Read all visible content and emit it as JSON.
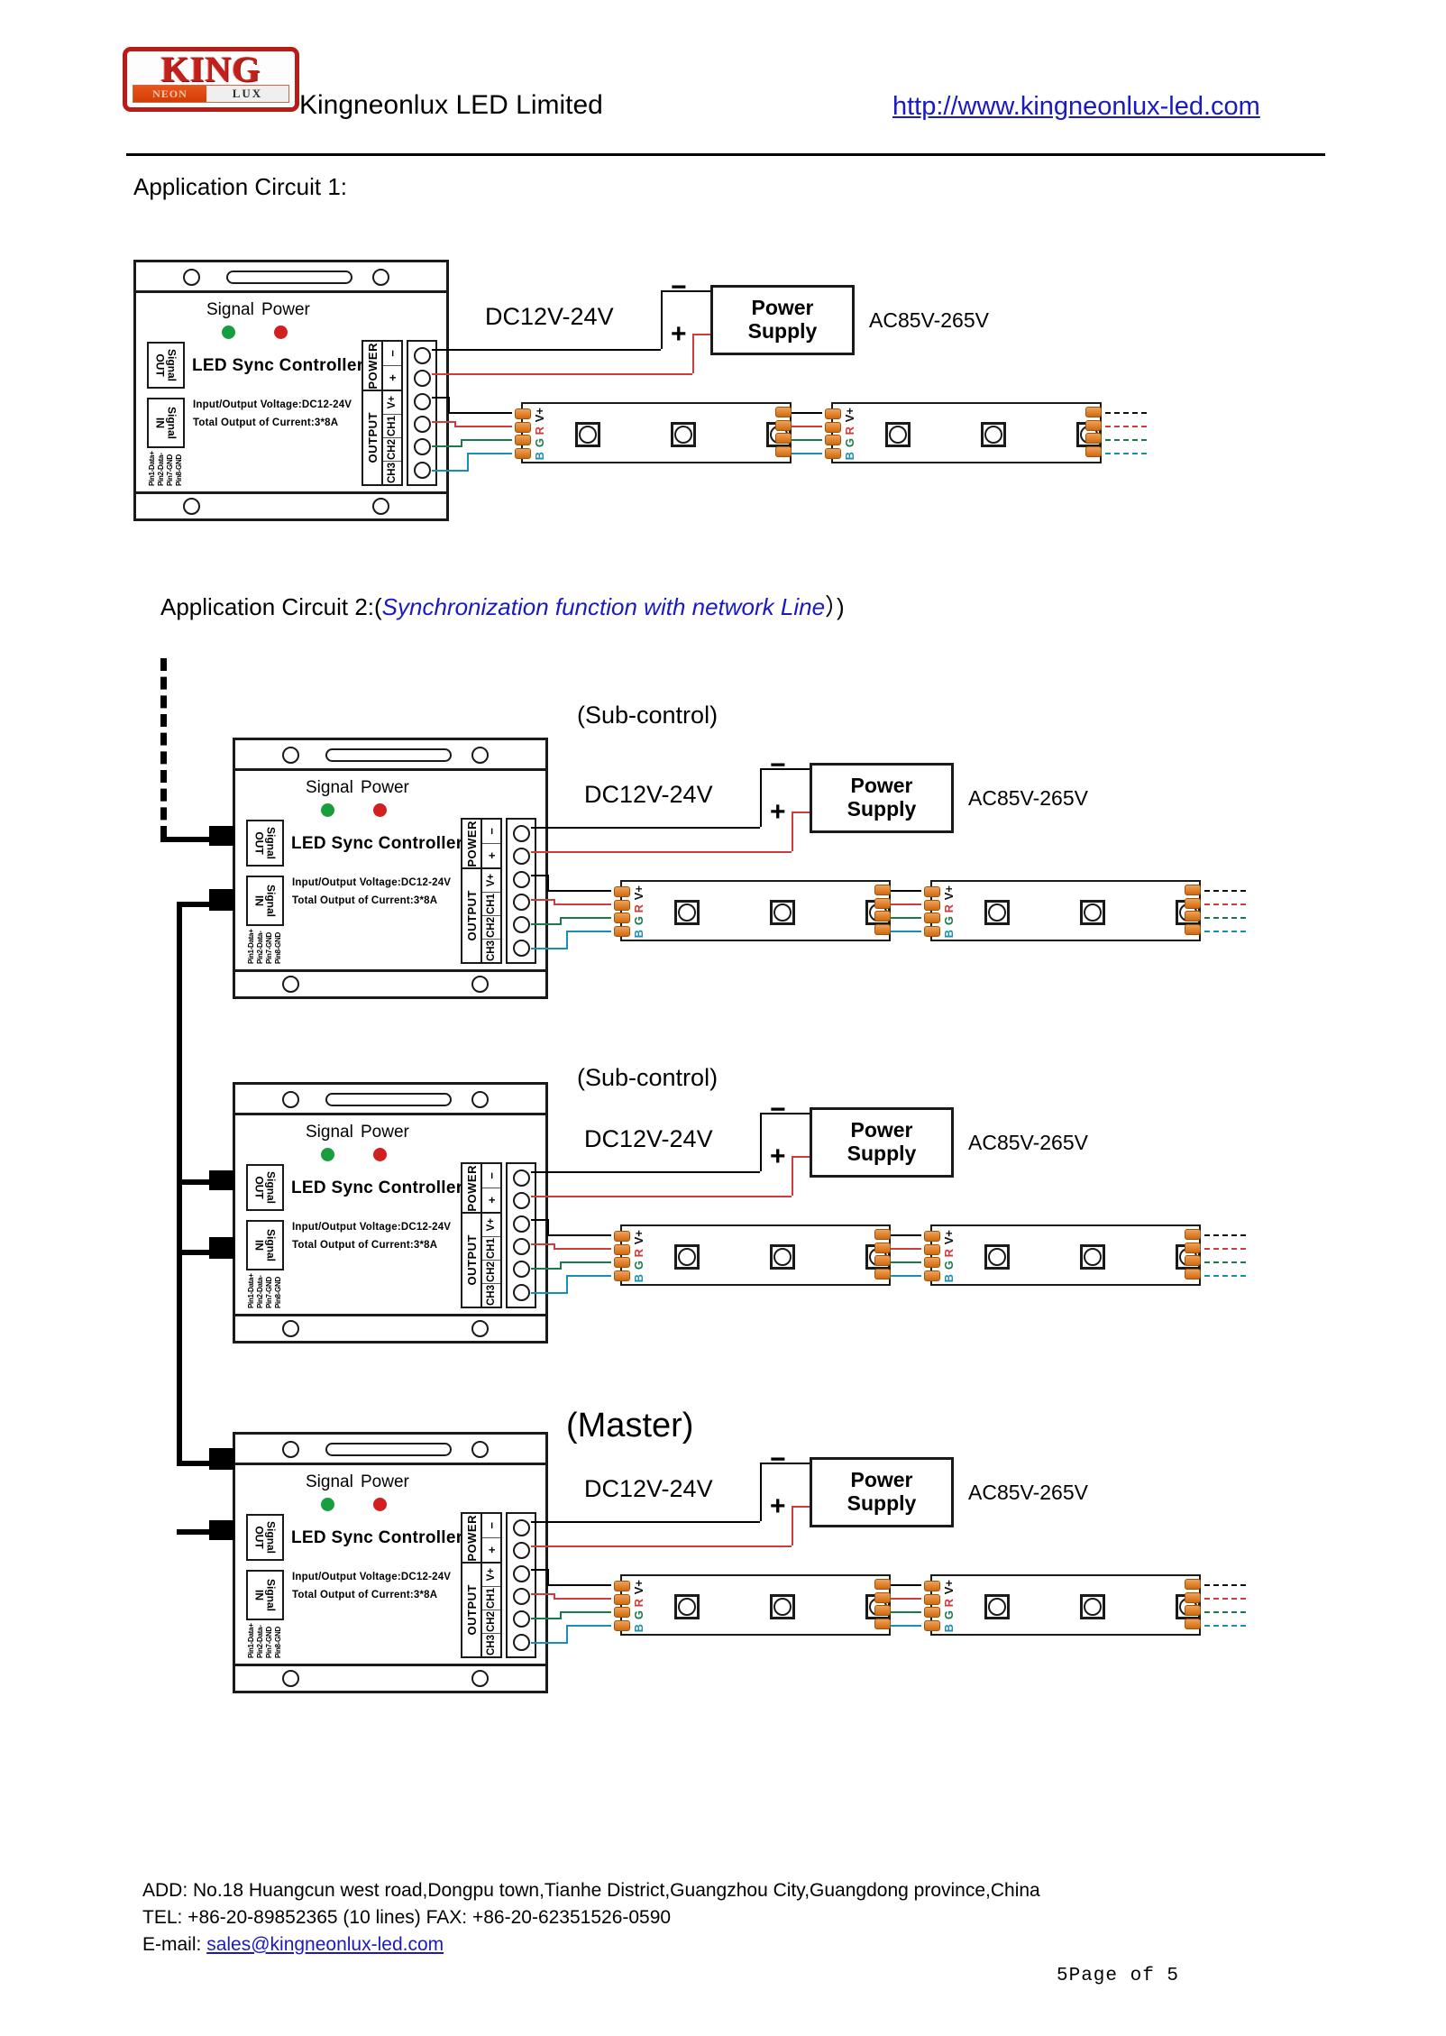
{
  "header": {
    "logo": {
      "king": "KING",
      "neon": "NEON",
      "lux": "LUX"
    },
    "company": "Kingneonlux LED Limited",
    "url": "http://www.kingneonlux-led.com"
  },
  "sections": {
    "circuit1_title": "Application Circuit 1:",
    "circuit2_prefix": "Application Circuit 2:(",
    "circuit2_italic": "Synchronization function with network Line",
    "circuit2_suffix": "）)"
  },
  "controller": {
    "signal_label": "Signal",
    "power_label": "Power",
    "signal_color": "#199e3f",
    "power_color": "#d21f1f",
    "name": "LED Sync Controller",
    "spec_line1": "Input/Output Voltage:DC12-24V",
    "spec_line2": "Total Output of Current:3*8A",
    "signal_out": "Signal OUT",
    "signal_in": "Signal IN",
    "pins": [
      "Pin1-Data+",
      "Pin2-Data-",
      "Pin7-GND",
      "Pin8-GND"
    ],
    "power_group": "POWER",
    "output_group": "OUTPUT",
    "power_terminals": [
      "−",
      "+"
    ],
    "output_terminals": [
      "V+",
      "CH1",
      "CH2",
      "CH3"
    ]
  },
  "supply": {
    "dc_label": "DC12V-24V",
    "title_line1": "Power",
    "title_line2": "Supply",
    "ac_label": "AC85V-265V",
    "minus": "−",
    "plus": "+"
  },
  "strip": {
    "pads": [
      "V+",
      "R",
      "G",
      "B"
    ],
    "pad_colors": [
      "#111111",
      "#d23b3b",
      "#1a7a4a",
      "#1a8fb5"
    ]
  },
  "roles": {
    "sub_control": "(Sub-control)",
    "master": "(Master)"
  },
  "circuit2_units": [
    {
      "role": "(Sub-control)"
    },
    {
      "role": "(Sub-control)"
    },
    {
      "role": "(Master)"
    }
  ],
  "footer": {
    "address": "ADD: No.18 Huangcun west road,Dongpu town,Tianhe District,Guangzhou City,Guangdong province,China",
    "phone": "TEL: +86-20-89852365 (10 lines) FAX: +86-20-62351526-0590",
    "email_label": "E-mail: ",
    "email": "sales@kingneonlux-led.com",
    "page": "5Page of 5"
  }
}
